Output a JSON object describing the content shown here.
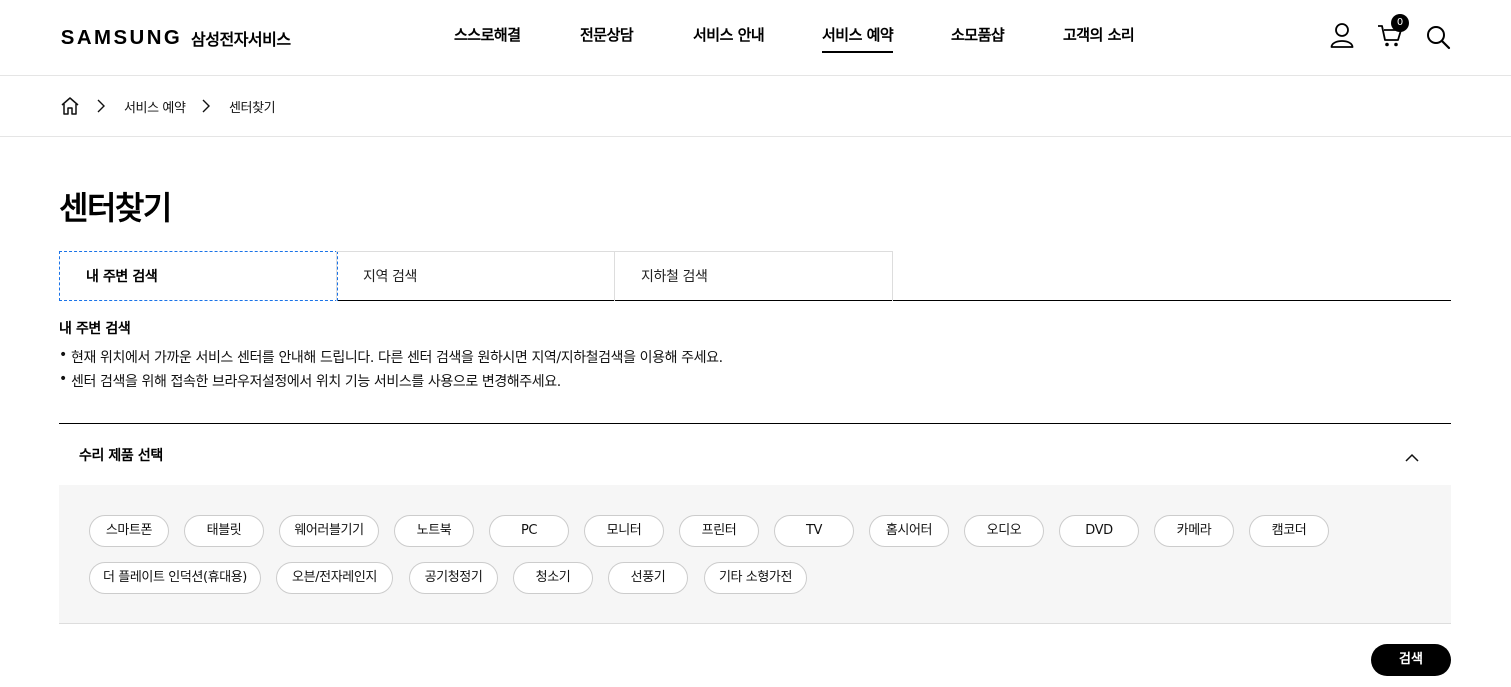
{
  "header": {
    "logo_word": "SAMSUNG",
    "logo_sub": "삼성전자서비스",
    "nav": [
      "스스로해결",
      "전문상담",
      "서비스 안내",
      "서비스 예약",
      "소모품샵",
      "고객의 소리"
    ],
    "active_nav": "서비스 예약",
    "cart_count": "0",
    "icons": {
      "user": "user-icon",
      "cart": "cart-icon",
      "search": "search-icon"
    }
  },
  "breadcrumb": {
    "home_icon": "home-icon",
    "items": [
      "서비스 예약",
      "센터찾기"
    ]
  },
  "page": {
    "title": "센터찾기"
  },
  "tabs": [
    "내 주변 검색",
    "지역 검색",
    "지하철 검색"
  ],
  "active_tab": "내 주변 검색",
  "info": {
    "title": "내 주변 검색",
    "lines": [
      "현재 위치에서 가까운 서비스 센터를 안내해 드립니다. 다른 센터 검색을 원하시면 지역/지하철검색을 이용해 주세요.",
      "센터 검색을 위해 접속한 브라우저설정에서 위치 기능 서비스를 사용으로 변경해주세요."
    ]
  },
  "product_select": {
    "title": "수리 제품 선택",
    "toggle_icon": "chevron-up-icon",
    "row1": [
      "스마트폰",
      "태블릿",
      "웨어러블기기",
      "노트북",
      "PC",
      "모니터",
      "프린터",
      "TV",
      "홈시어터",
      "오디오",
      "DVD",
      "카메라",
      "캠코더"
    ],
    "row2": [
      "더 플레이트 인덕션(휴대용)",
      "오븐/전자레인지",
      "공기청정기",
      "청소기",
      "선풍기",
      "기타 소형가전"
    ]
  },
  "search_button": "검색",
  "colors": {
    "accent": "#000000",
    "focus": "#1a73e8",
    "panel": "#f6f6f6"
  }
}
